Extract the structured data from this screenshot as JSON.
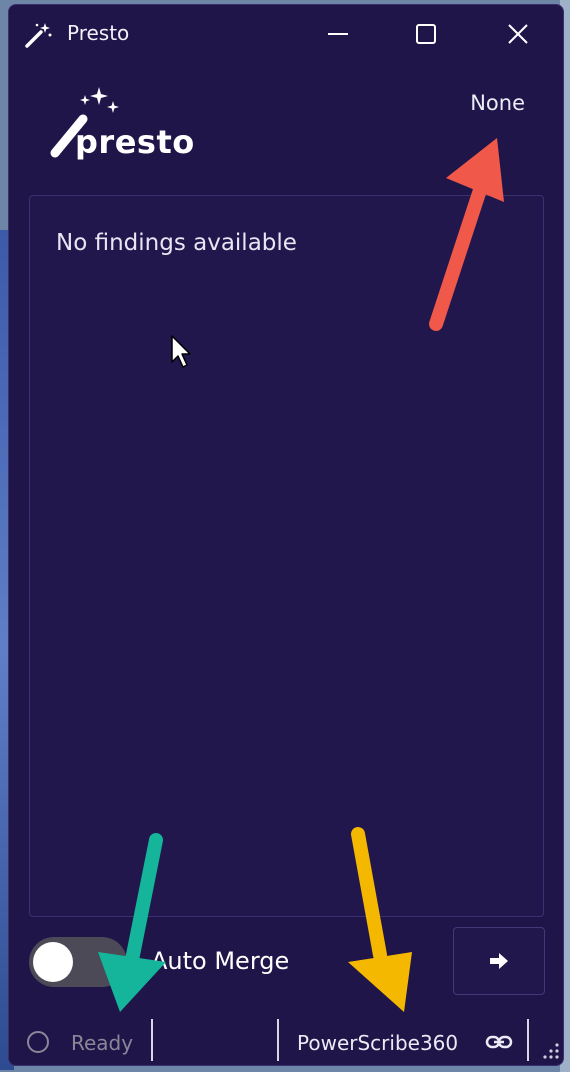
{
  "window": {
    "title": "Presto",
    "icon": "magic-wand-icon",
    "controls": [
      "minimize-icon",
      "maximize-icon",
      "close-icon"
    ]
  },
  "header": {
    "logo_text": "presto",
    "selection": "None"
  },
  "findings": {
    "empty_message": "No findings available"
  },
  "controls": {
    "auto_merge_label": "Auto Merge",
    "auto_merge_enabled": false,
    "send_icon": "arrow-right-icon"
  },
  "status": {
    "state": "Ready",
    "integration": "PowerScribe360",
    "link_icon": "link-icon"
  },
  "colors": {
    "window_bg": "#1f1549",
    "panel_border": "#3c3170",
    "annotation_red": "#f0594a",
    "annotation_teal": "#14b59a",
    "annotation_yellow": "#f5b800"
  }
}
